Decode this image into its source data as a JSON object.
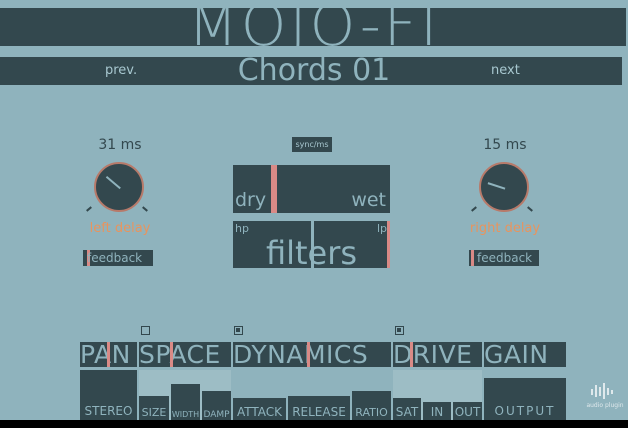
{
  "app": {
    "logo": "MOJO-FI"
  },
  "preset": {
    "name": "Chords 01",
    "prev_label": "prev.",
    "next_label": "next"
  },
  "left_delay": {
    "value": "31 ms",
    "label": "left delay",
    "feedback_label": "feedback"
  },
  "right_delay": {
    "value": "15 ms",
    "label": "right delay",
    "feedback_label": "feedback"
  },
  "center": {
    "sync_label": "sync/ms",
    "dry_label": "dry",
    "wet_label": "wet",
    "hp_label": "hp",
    "lp_label": "lp",
    "filters_label": "filters"
  },
  "modules": {
    "pan": "PAN",
    "space": "SPACE",
    "dynamics": "DYNAMICS",
    "drive": "DRIVE",
    "gain": "GAIN"
  },
  "params": {
    "stereo": "STEREO",
    "size": "SIZE",
    "width": "WIDTH",
    "damp": "DAMP",
    "attack": "ATTACK",
    "release": "RELEASE",
    "ratio": "RATIO",
    "sat": "SAT",
    "in": "IN",
    "out": "OUT",
    "output": "OUTPUT"
  },
  "watermark": "audio plugin"
}
